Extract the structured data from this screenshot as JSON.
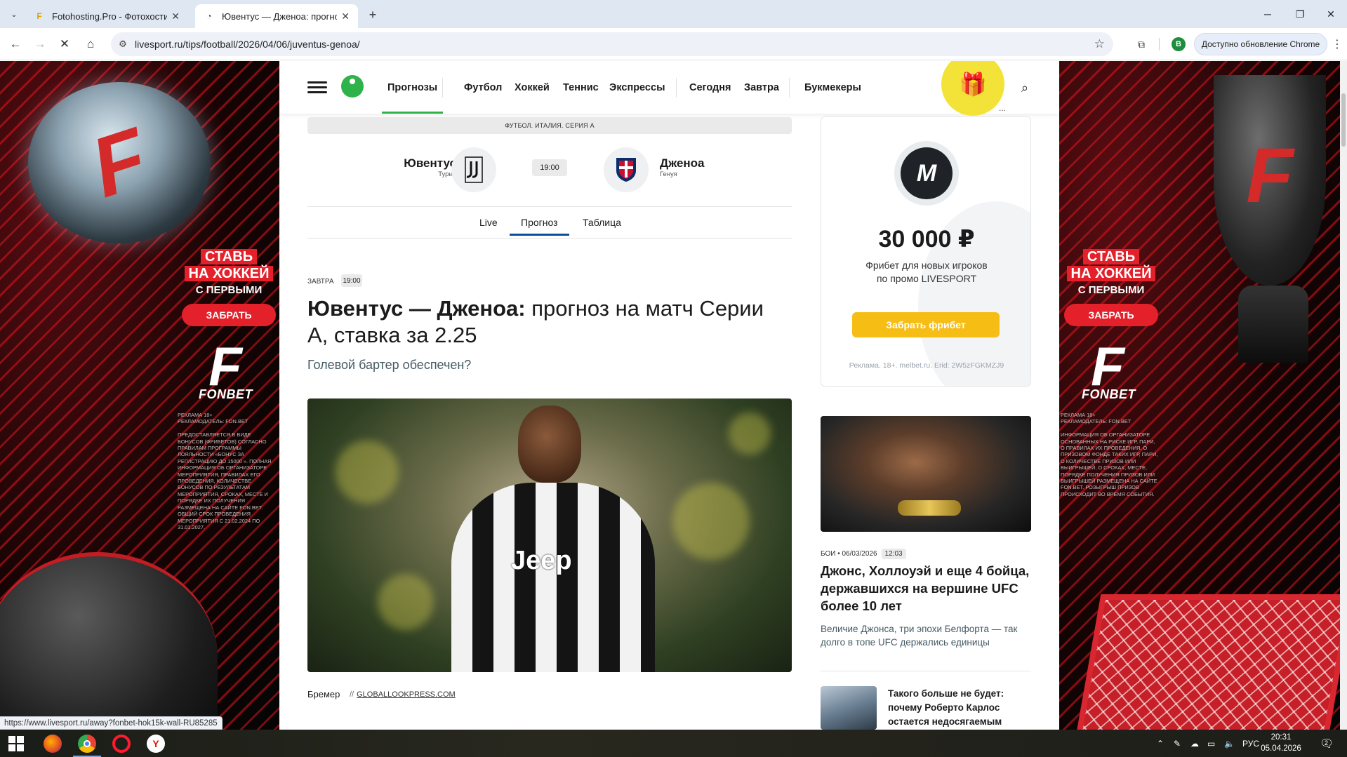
{
  "browser": {
    "tabs": [
      {
        "title": "Fotohosting.Pro - Фотохостинг",
        "icon": "fotohosting-favicon",
        "active": false
      },
      {
        "title": "Ювентус — Дженоа: прогноз",
        "icon": "livesport-favicon",
        "active": true
      }
    ],
    "url": "livesport.ru/tips/football/2026/04/06/juventus-genoa/",
    "profile_initial": "B",
    "update_label": "Доступно обновление Chrome",
    "status_url": "https://www.livesport.ru/away?fonbet-hok15k-wall-RU85285"
  },
  "ad_side": {
    "headline_line1": "СТАВЬ",
    "headline_line2": "НА ХОККЕЙ",
    "headline_line3": "С ПЕРВЫМИ",
    "button": "ЗАБРАТЬ",
    "brand": "FONBET",
    "brand_letter": "F",
    "left_fine": "РЕКЛАМА 18+\nРЕКЛАМОДАТЕЛЬ: FON.BET\n\nПРЕДОСТАВЛЯЕТСЯ В ВИДЕ БОНУСОВ (ФРИБЕТОВ) СОГЛАСНО ПРАВИЛАМ ПРОГРАММЫ ЛОЯЛЬНОСТИ «БОНУС ЗА РЕГИСТРАЦИЮ ДО 15000 ». ПОЛНАЯ ИНФОРМАЦИЯ ОБ ОРГАНИЗАТОРЕ МЕРОПРИЯТИЯ, ПРАВИЛАХ ЕГО ПРОВЕДЕНИЯ, КОЛИЧЕСТВЕ БОНУСОВ ПО РЕЗУЛЬТАТАМ МЕРОПРИЯТИЯ, СРОКАХ, МЕСТЕ И ПОРЯДКЕ ИХ ПОЛУЧЕНИЯ РАЗМЕЩЕНА НА САЙТЕ FON.BET. ОБЩИЙ СРОК ПРОВЕДЕНИЯ МЕРОПРИЯТИЯ С 21.02.2024 ПО 31.01.2027.",
    "right_fine": "РЕКЛАМА 18+\nРЕКЛАМОДАТЕЛЬ: FON.BET\n\nИНФОРМАЦИЯ ОБ ОРГАНИЗАТОРЕ ОСНОВАННЫХ НА РИСКЕ ИГР, ПАРИ, О ПРАВИЛАХ ИХ ПРОВЕДЕНИЯ, О ПРИЗОВОМ ФОНДЕ ТАКИХ ИГР, ПАРИ, О КОЛИЧЕСТВЕ ПРИЗОВ ИЛИ ВЫИГРЫШЕЙ, О СРОКАХ, МЕСТЕ, ПОРЯДКЕ ПОЛУЧЕНИЯ ПРИЗОВ ИЛИ ВЫИГРЫШЕЙ РАЗМЕЩЕНА НА САЙТЕ FON.BET. РОЗЫГРЫШ ПРИЗОВ ПРОИСХОДИТ ВО ВРЕМЯ СОБЫТИЯ."
  },
  "site_nav": {
    "items": [
      "Прогнозы",
      "Футбол",
      "Хоккей",
      "Теннис",
      "Экспрессы",
      "Сегодня",
      "Завтра",
      "Букмекеры"
    ],
    "active": "Прогнозы",
    "more_dots": "..."
  },
  "match": {
    "league": "ФУТБОЛ. ИТАЛИЯ. СЕРИЯ А",
    "home": {
      "name": "Ювентус",
      "city": "Турин"
    },
    "away": {
      "name": "Дженоа",
      "city": "Генуя"
    },
    "time": "19:00",
    "tabs": [
      "Live",
      "Прогноз",
      "Таблица"
    ],
    "active_tab": "Прогноз"
  },
  "article": {
    "day": "ЗАВТРА",
    "time": "19:00",
    "title_bold": "Ювентус — Дженоа:",
    "title_rest": " прогноз на матч Серии А, ставка за 2.25",
    "subtitle": "Голевой бартер обеспечен?",
    "image_jersey_text": "Jeep",
    "caption": "Бремер",
    "caption_sep": "//",
    "caption_source": "GLOBALLOOKPRESS.COM"
  },
  "promo": {
    "logo_letter": "M",
    "amount": "30 000 ₽",
    "desc_line1": "Фрибет для новых игроков",
    "desc_line2": "по промо LIVESPORT",
    "button": "Забрать фрибет",
    "legal": "Реклама. 18+. melbet.ru. Erid: 2W5zFGKMZJ9"
  },
  "news": [
    {
      "category": "БОИ",
      "date": "06/03/2026",
      "time": "12:03",
      "title": "Джонс, Холлоуэй и еще 4 бойца, державшихся на вершине UFC более 10 лет",
      "lead": "Величие Джонса, три эпохи Белфорта — так долго в топе UFC держались единицы"
    },
    {
      "title": "Такого больше не будет: почему Роберто Карлос остается недосягаемым"
    }
  ],
  "taskbar": {
    "tray_lang": "РУС",
    "time": "20:31",
    "date": "05.04.2026",
    "notif_count": "2"
  },
  "colors": {
    "livesport_green": "#2eb34a",
    "promo_yellow": "#f6bd15",
    "fonbet_red": "#e4202a",
    "gift_yellow": "#f3e338"
  }
}
